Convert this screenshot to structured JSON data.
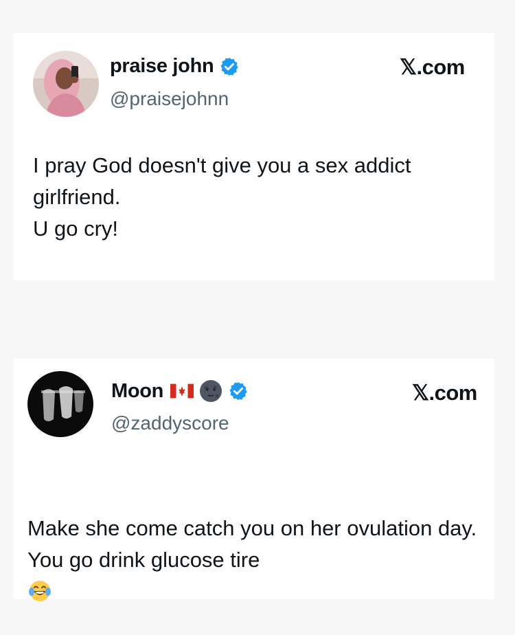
{
  "tweets": [
    {
      "display_name": "praise john",
      "handle": "@praisejohnn",
      "site": "𝕏.com",
      "text": "I pray God doesn't give you a sex addict girlfriend.\nU go cry!",
      "verified": true,
      "avatar_icon": "profile-photo-woman"
    },
    {
      "display_name": "Moon",
      "handle": "@zaddyscore",
      "site": "𝕏.com",
      "text": "Make she come catch you on her ovulation day. You go drink glucose tire",
      "verified": true,
      "name_emojis": [
        "canada-flag-icon",
        "new-moon-face-icon"
      ],
      "trailing_emoji": "face-with-tears-of-joy-icon",
      "avatar_icon": "profile-photo-dark"
    }
  ],
  "colors": {
    "verified_blue": "#1d9bf0",
    "handle_gray": "#536471",
    "text": "#0f1419",
    "background": "#f7f7f7"
  }
}
